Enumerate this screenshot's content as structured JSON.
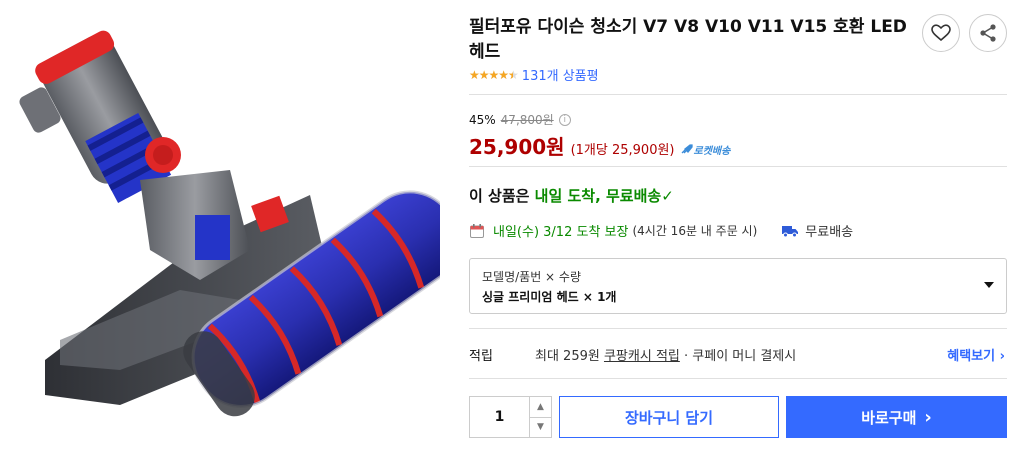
{
  "product": {
    "title": "필터포유 다이슨 청소기 V7 V8 V10 V11 V15 호환 LED 헤드",
    "rating": 4.5,
    "review_count": "131개 상품평"
  },
  "price": {
    "discount_percent": "45%",
    "original_price": "47,800원",
    "sale_price": "25,900원",
    "unit_price": "(1개당 25,900원)",
    "rocket_label": "로켓배송"
  },
  "arrival": {
    "prefix": "이 상품은 ",
    "highlight": "내일 도착, 무료배송",
    "check": "✓"
  },
  "delivery": {
    "date_text": "내일(수) 3/12 도착 보장",
    "cutoff_text": "(4시간 16분 내 주문 시)",
    "free_shipping": "무료배송"
  },
  "option": {
    "label": "모델명/품번 × 수량",
    "value": "싱글 프리미엄 헤드 × 1개"
  },
  "reward": {
    "label": "적립",
    "text_prefix": "최대 259원 ",
    "text_link": "쿠팡캐시 적립",
    "text_suffix": " · 쿠페이 머니 결제시",
    "benefit_link": "혜택보기 ›"
  },
  "purchase": {
    "quantity": "1",
    "cart_label": "장바구니 담기",
    "buy_label": "바로구매",
    "buy_arrow": "›"
  },
  "colors": {
    "accent": "#346aff",
    "price_red": "#ae0000",
    "green": "#0a8a00"
  }
}
